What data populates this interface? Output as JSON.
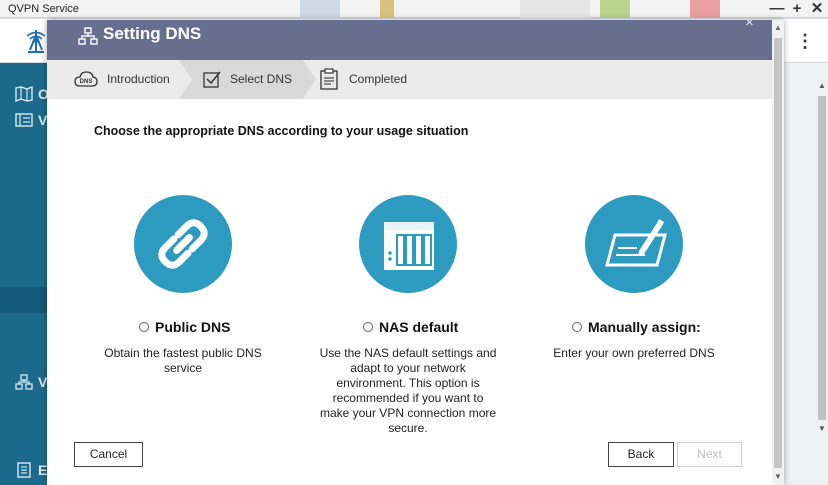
{
  "window": {
    "title": "QVPN Service",
    "controls": {
      "minimize": "—",
      "maximize": "+",
      "close": "✕"
    }
  },
  "app": {
    "menu_icon": "⋮",
    "sidebar": {
      "items": [
        {
          "icon": "map-icon",
          "label": "O"
        },
        {
          "icon": "list-icon",
          "label": "V"
        },
        {
          "icon": "network-icon",
          "label": "V"
        },
        {
          "icon": "document-icon",
          "label": "E"
        }
      ]
    }
  },
  "dialog": {
    "title": "Setting DNS",
    "close_glyph": "×",
    "steps": [
      {
        "label": "Introduction",
        "icon": "dns-cloud-icon",
        "state": "done"
      },
      {
        "label": "Select DNS",
        "icon": "checkbox-icon",
        "state": "active"
      },
      {
        "label": "Completed",
        "icon": "clipboard-icon",
        "state": "pending"
      }
    ],
    "instruction": "Choose the appropriate DNS according to your usage situation",
    "dns_icon_text": "DNS",
    "options": [
      {
        "title": "Public DNS",
        "description": "Obtain the fastest public DNS service",
        "icon": "link-icon",
        "selected": false
      },
      {
        "title": "NAS default",
        "description": "Use the NAS default settings and adapt to your network environment. This option is recommended if you want to make your VPN connection more secure.",
        "icon": "nas-icon",
        "selected": false
      },
      {
        "title": "Manually assign:",
        "description": "Enter your own preferred DNS",
        "icon": "pen-form-icon",
        "selected": false
      }
    ],
    "buttons": {
      "cancel": "Cancel",
      "back": "Back",
      "next": "Next"
    }
  },
  "colors": {
    "header": "#676f8f",
    "accent": "#2d9ac0",
    "sidebar": "#1b6a8c"
  }
}
